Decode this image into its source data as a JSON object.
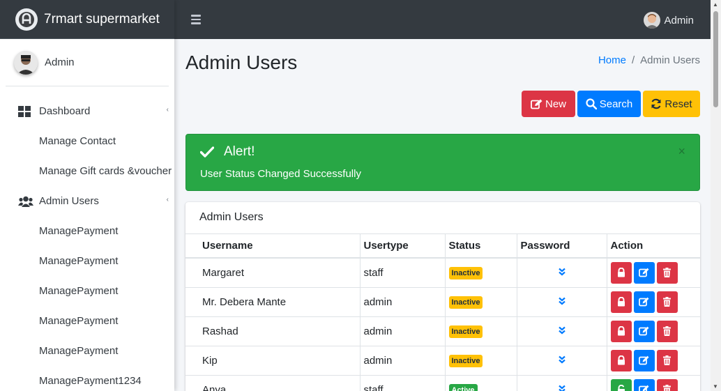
{
  "brand": {
    "name": "7rmart supermarket"
  },
  "sidebar": {
    "user": "Admin",
    "items": [
      {
        "label": "Dashboard",
        "type": "top",
        "icon": "dashboard-icon",
        "caret": true
      },
      {
        "label": "Manage Contact",
        "type": "sub"
      },
      {
        "label": "Manage Gift cards &voucher",
        "type": "sub"
      },
      {
        "label": "Admin Users",
        "type": "top",
        "icon": "users-icon",
        "caret": true
      },
      {
        "label": "ManagePayment",
        "type": "sub"
      },
      {
        "label": "ManagePayment",
        "type": "sub"
      },
      {
        "label": "ManagePayment",
        "type": "sub"
      },
      {
        "label": "ManagePayment",
        "type": "sub"
      },
      {
        "label": "ManagePayment",
        "type": "sub"
      },
      {
        "label": "ManagePayment1234",
        "type": "sub"
      }
    ]
  },
  "header": {
    "user": "Admin"
  },
  "page": {
    "title": "Admin Users",
    "breadcrumb": {
      "home": "Home",
      "separator": "/",
      "current": "Admin Users"
    }
  },
  "toolbar": {
    "new_label": "New",
    "search_label": "Search",
    "reset_label": "Reset"
  },
  "alert": {
    "title": "Alert!",
    "message": "User Status Changed Successfully",
    "close": "×"
  },
  "table": {
    "title": "Admin Users",
    "columns": [
      "Username",
      "Usertype",
      "Status",
      "Password",
      "Action"
    ],
    "rows": [
      {
        "username": "Margaret",
        "usertype": "staff",
        "status": "Inactive"
      },
      {
        "username": "Mr. Debera Mante",
        "usertype": "admin",
        "status": "Inactive"
      },
      {
        "username": "Rashad",
        "usertype": "admin",
        "status": "Inactive"
      },
      {
        "username": "Kip",
        "usertype": "admin",
        "status": "Inactive"
      },
      {
        "username": "Anya",
        "usertype": "staff",
        "status": "Active"
      }
    ]
  },
  "colors": {
    "header_bg": "#343a40",
    "success": "#28a745",
    "danger": "#dc3545",
    "primary": "#007bff",
    "warning": "#ffc107"
  }
}
